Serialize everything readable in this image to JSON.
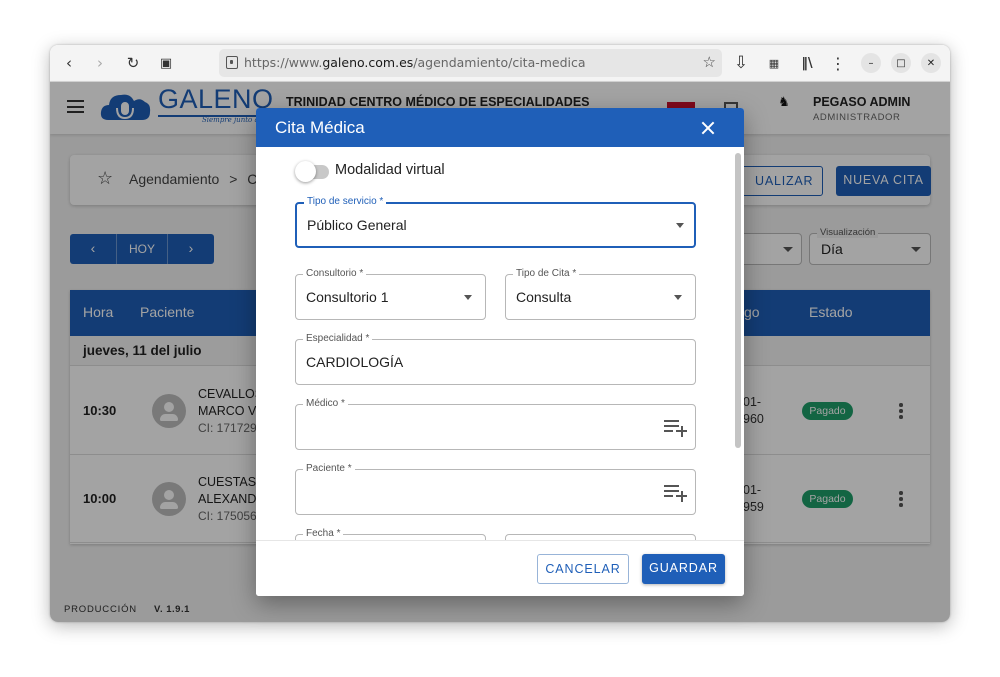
{
  "browser": {
    "url_prefix": "https://www.",
    "url_host": "galeno.com.es",
    "url_path": "/agendamiento/cita-medica"
  },
  "header": {
    "logo_text": "GALENO",
    "logo_tagline": "Siempre junto a ti",
    "clinic_name": "TRINIDAD CENTRO MÉDICO DE ESPECIALIDADES",
    "user_name": "PEGASO ADMIN",
    "user_role": "ADMINISTRADOR",
    "user_logo_text": "PEGASO"
  },
  "breadcrumb": {
    "section": "Agendamiento",
    "separator": ">",
    "current_partial": "C",
    "refresh_button_partial": "UALIZAR",
    "new_button": "NUEVA CITA"
  },
  "calendar_nav": {
    "prev": "‹",
    "today": "HOY",
    "next": "›"
  },
  "view_select": {
    "label": "Visualización",
    "value": "Día"
  },
  "table": {
    "headers": {
      "time": "Hora",
      "patient": "Paciente",
      "code_partial": "go",
      "status": "Estado"
    },
    "day_label": "jueves, 11 del julio",
    "rows": [
      {
        "time": "10:30",
        "name_line1": "CEVALLOS",
        "name_line2": "MARCO VI",
        "ci": "CI: 171729",
        "code_line1": "01-",
        "code_line2": "960",
        "status": "Pagado"
      },
      {
        "time": "10:00",
        "name_line1": "CUESTAS E",
        "name_line2": "ALEXAND",
        "ci": "CI: 175056",
        "code_line1": "01-",
        "code_line2": "959",
        "status": "Pagado"
      }
    ]
  },
  "footer": {
    "env": "PRODUCCIÓN",
    "version": "V. 1.9.1"
  },
  "dialog": {
    "title": "Cita Médica",
    "virtual_toggle_label": "Modalidad virtual",
    "fields": {
      "service_type": {
        "label": "Tipo de servicio *",
        "value": "Público General"
      },
      "office": {
        "label": "Consultorio *",
        "value": "Consultorio 1"
      },
      "appointment_type": {
        "label": "Tipo de Cita *",
        "value": "Consulta"
      },
      "specialty": {
        "label": "Especialidad *",
        "value": "CARDIOLOGÍA"
      },
      "doctor": {
        "label": "Médico *",
        "value": ""
      },
      "patient": {
        "label": "Paciente *",
        "value": ""
      },
      "date": {
        "label": "Fecha *",
        "value": ""
      }
    },
    "cancel_label": "CANCELAR",
    "save_label": "GUARDAR"
  },
  "colors": {
    "primary": "#1f5fb8",
    "paid_badge": "#1e9e6a"
  }
}
